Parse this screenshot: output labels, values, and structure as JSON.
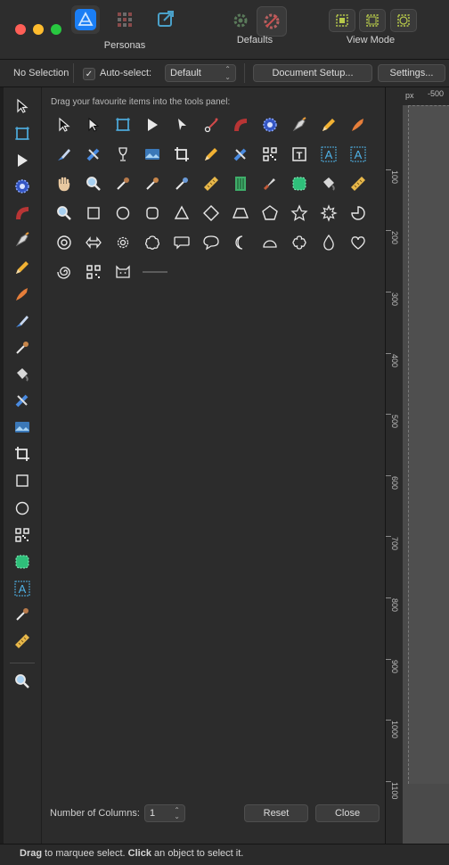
{
  "titlebar": {
    "personas_label": "Personas",
    "defaults_label": "Defaults",
    "view_mode_label": "View Mode"
  },
  "context_bar": {
    "selection_status": "No Selection",
    "auto_select_label": "Auto-select:",
    "auto_select_checked": true,
    "auto_select_value": "Default",
    "document_setup_label": "Document Setup...",
    "settings_label": "Settings..."
  },
  "tools_panel": {
    "instruction": "Drag your favourite items into the tools panel:",
    "columns_label": "Number of Columns:",
    "columns_value": "1",
    "reset_label": "Reset",
    "close_label": "Close",
    "rows": [
      [
        "move-tool",
        "node-tool",
        "artboard-tool",
        "corner-tool",
        "point-transform-tool",
        "pen-tool-anchor",
        "fill-tool",
        "transparency-tool",
        "vector-pen-tool",
        "pencil-tool",
        "vector-brush-tool"
      ],
      [
        "paint-brush-tool",
        "paint-mixer-tool",
        "wineglass-place-tool",
        "place-image-tool",
        "crop-tool",
        "pencil-tool-2",
        "brush-tool-2",
        "qr-code-tool",
        "frame-text-tool",
        "artistic-text-tool",
        "text-path-tool"
      ],
      [
        "hand-tool",
        "zoom-tool",
        "eyedropper-tool",
        "color-picker-tool",
        "gradient-eyedropper-tool",
        "measure-tool",
        "area-tool",
        "knife-tool",
        "shape-builder-tool",
        "fill-bucket-tool",
        "ruler-tool"
      ],
      [
        "zoom-tool-2",
        "rectangle-tool",
        "ellipse-tool",
        "rounded-rectangle-tool",
        "triangle-tool",
        "diamond-tool",
        "trapezoid-tool",
        "pentagon-tool",
        "star-tool",
        "sun-gear-tool",
        "pie-tool"
      ],
      [
        "donut-tool",
        "double-arrow-tool",
        "cog-tool",
        "cloud-shape-tool",
        "callout-rect-tool",
        "callout-ellipse-tool",
        "crescent-tool",
        "segment-tool",
        "flower-tool",
        "teardrop-tool",
        "heart-tool"
      ],
      [
        "spiral-tool",
        "qr-code-tool-2",
        "cat-tool",
        "line-tool"
      ]
    ]
  },
  "left_toolbar": {
    "tools": [
      "move-tool",
      "artboard-tool",
      "corner-tool",
      "transparency-tool",
      "fill-tool",
      "vector-pen-tool",
      "pencil-tool",
      "vector-brush-tool",
      "paint-brush-tool",
      "color-picker-tool",
      "fill-bucket-tool",
      "paint-mixer-tool",
      "place-image-tool",
      "crop-tool",
      "rectangle-tool",
      "ellipse-tool",
      "qr-code-tool",
      "shape-builder-tool",
      "artistic-text-tool",
      "eyedropper-tool",
      "ruler-tool",
      "zoom-tool"
    ]
  },
  "ruler": {
    "unit": "px",
    "top_value": "-500",
    "labels": [
      "100",
      "200",
      "300",
      "400",
      "500",
      "600",
      "700",
      "800",
      "900",
      "1000",
      "1100"
    ]
  },
  "status_bar": {
    "drag_bold": "Drag",
    "drag_text": " to marquee select. ",
    "click_bold": "Click",
    "click_text": " an object to select it."
  },
  "colors": {
    "accent": "#2d8cf0",
    "window_bg": "#2c2c2c",
    "canvas_bg": "#4a4a4a"
  }
}
